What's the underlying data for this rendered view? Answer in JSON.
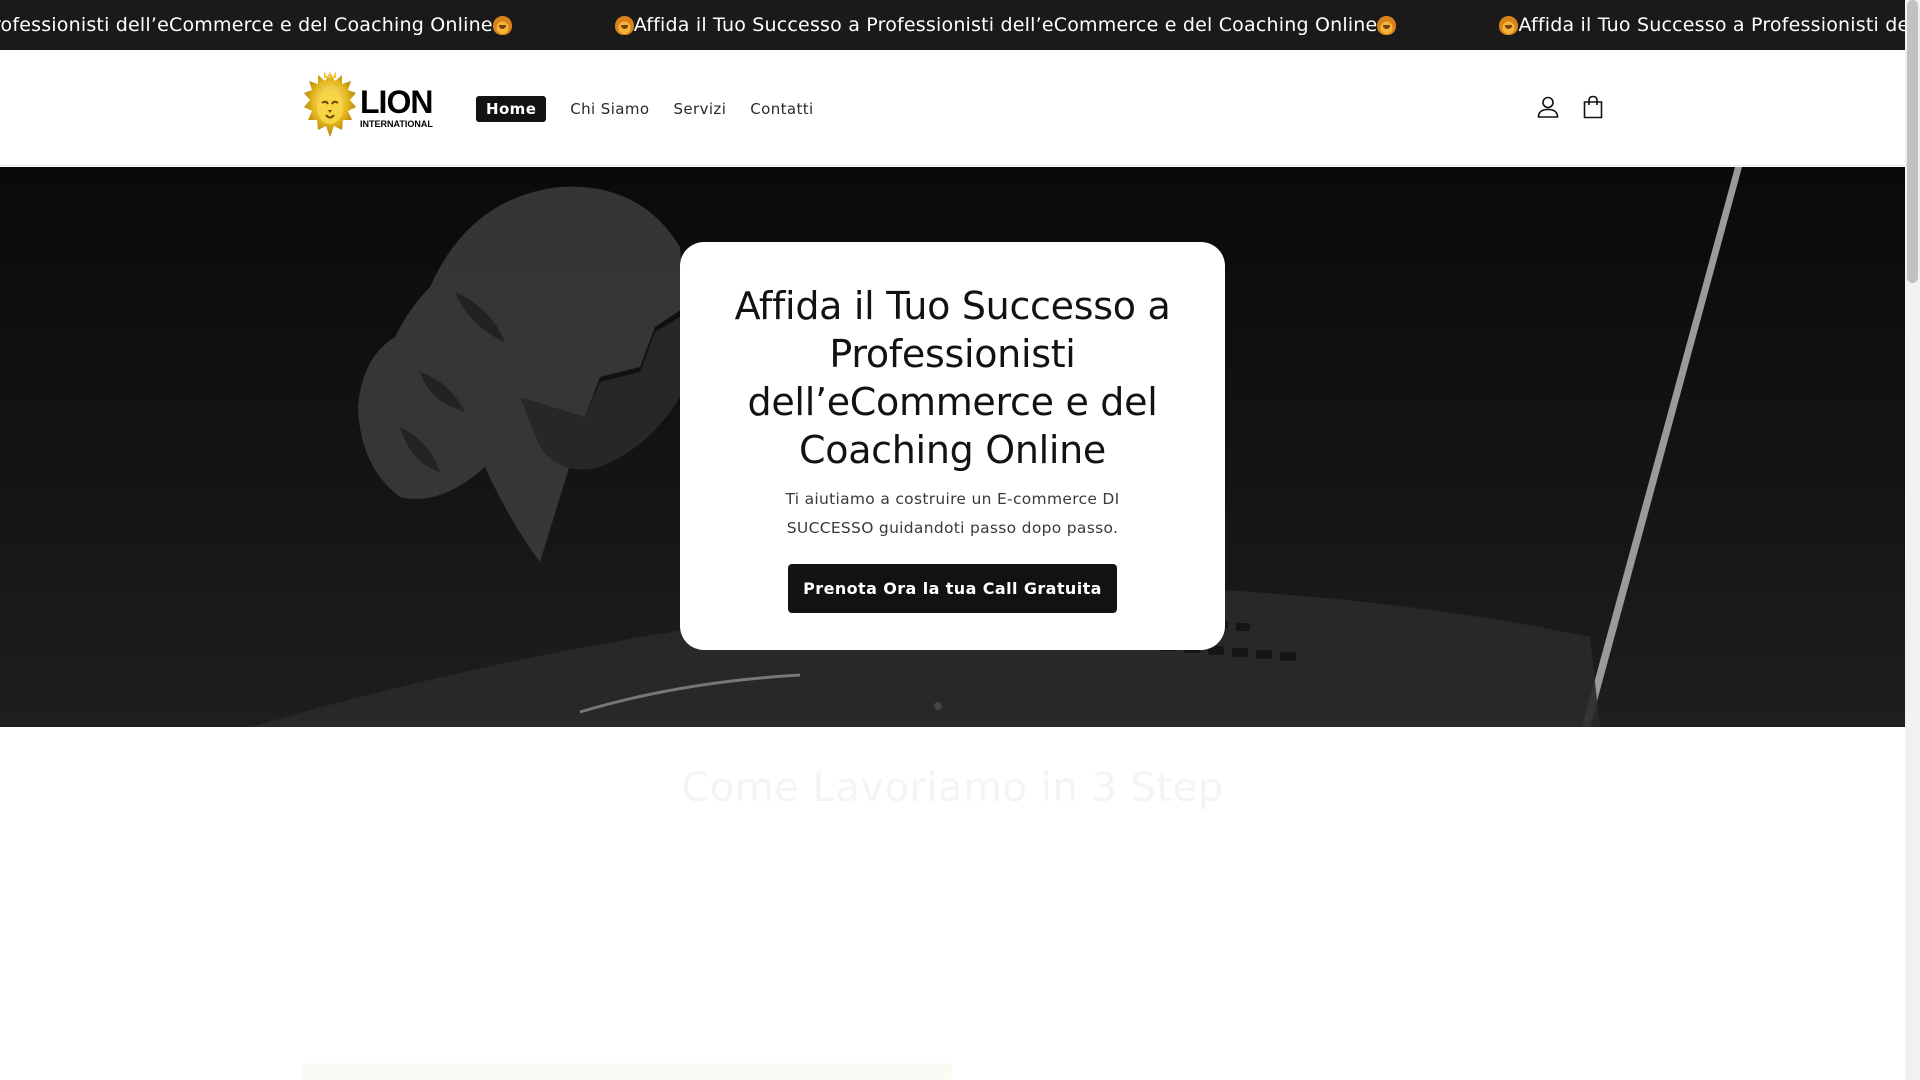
{
  "announcement": {
    "messages": [
      "Affida il Tuo Successo a Professionisti dell’eCommerce e del Coaching Online",
      "Affida il Tuo Successo a Professionisti dell’eCommerce e del Coaching Online",
      "Affida il Tuo Successo a Professionisti dell’eCommerce e del Coaching Online"
    ]
  },
  "header": {
    "logo_main": "LION",
    "logo_sub": "INTERNATIONAL",
    "nav": [
      "Home",
      "Chi Siamo",
      "Servizi",
      "Contatti"
    ],
    "active_nav": "Home",
    "icons": [
      "account-icon",
      "cart-icon"
    ]
  },
  "hero": {
    "title": "Affida il Tuo Successo a Professionisti dell’eCommerce e del Coaching Online",
    "subtitle": "Ti aiutiamo a costruire un E-commerce DI SUCCESSO guidandoti passo dopo passo.",
    "cta": "Prenota Ora la tua Call Gratuita"
  },
  "steps": {
    "title": "Come Lavoriamo in 3 Step"
  },
  "colors": {
    "announcement_bg": "#1a1a1a",
    "button_bg": "#121212",
    "logo_gold": "#e0b21c"
  }
}
